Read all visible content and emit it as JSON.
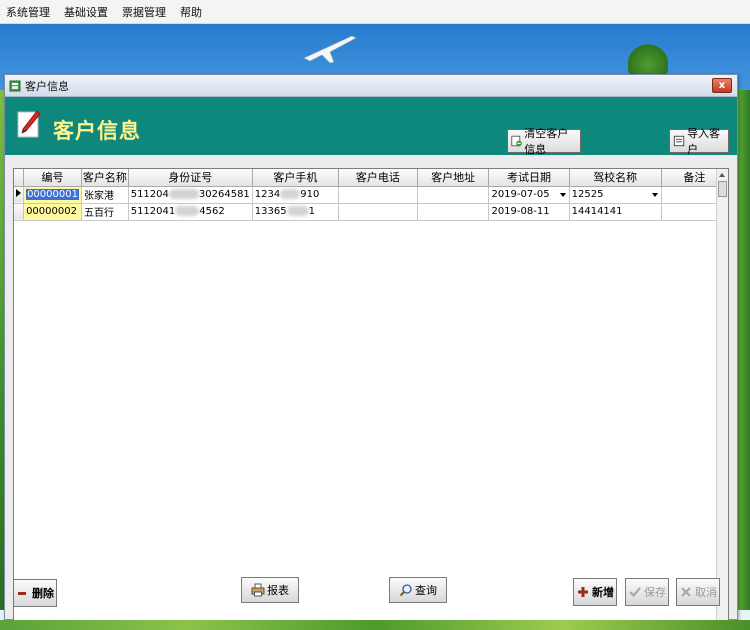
{
  "menu": [
    "系统管理",
    "基础设置",
    "票据管理",
    "帮助"
  ],
  "window": {
    "title": "客户信息",
    "close_label": "x"
  },
  "header": {
    "title": "客户信息"
  },
  "toolbar": {
    "clear_label": "清空客户信息",
    "import_label": "导入客户"
  },
  "table": {
    "columns": [
      "编号",
      "客户名称",
      "身份证号",
      "客户手机",
      "客户电话",
      "客户地址",
      "考试日期",
      "驾校名称",
      "备注"
    ],
    "rows": [
      {
        "id": "00000001",
        "name": "张家港",
        "id_card_a": "511204",
        "id_card_b": "30264581",
        "mobile_a": "1234",
        "mobile_b": "910",
        "phone": "",
        "address": "",
        "exam_date": "2019-07-05",
        "school": "12525",
        "remark": ""
      },
      {
        "id": "00000002",
        "name": "五百行",
        "id_card_a": "5112041",
        "id_card_b": "4562",
        "mobile_a": "13365",
        "mobile_b": "1",
        "phone": "",
        "address": "",
        "exam_date": "2019-08-11",
        "school": "14414141",
        "remark": ""
      }
    ]
  },
  "buttons": {
    "delete": "删除",
    "report": "报表",
    "query": "查询",
    "add": "新增",
    "save": "保存",
    "cancel": "取消"
  },
  "colors": {
    "header_bg": "#0e877d",
    "header_title": "#fff38a",
    "id_cell_bg": "#fffaa0",
    "selection": "#3b71d6"
  }
}
